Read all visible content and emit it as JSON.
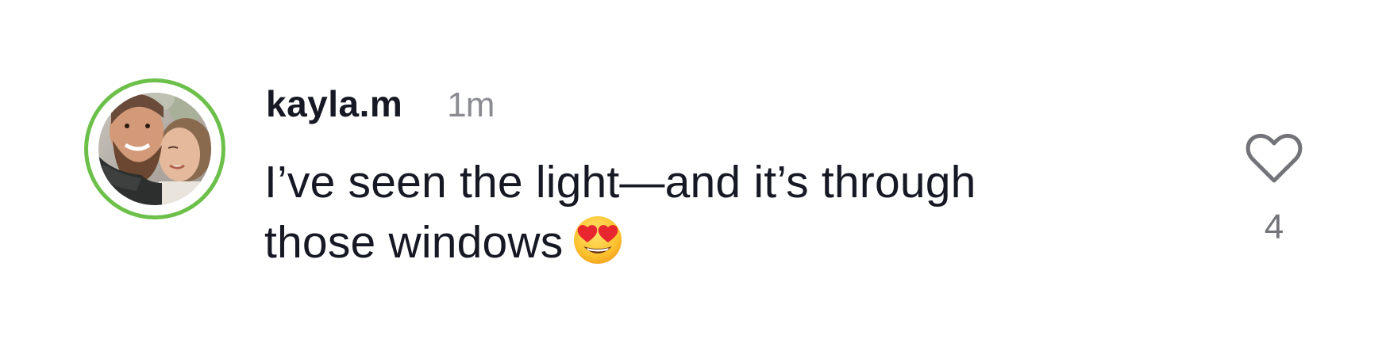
{
  "comment": {
    "username": "kayla.m",
    "timestamp": "1m",
    "text": "I’ve seen the light—and it’s through those windows",
    "emoji": "smiling-face-with-heart-eyes",
    "like_icon": "heart-outline-icon",
    "like_count": "4"
  },
  "colors": {
    "avatar_ring": "#6cc04a",
    "text_primary": "#161823",
    "text_secondary": "#8a8b91",
    "like_count": "#73747a"
  }
}
